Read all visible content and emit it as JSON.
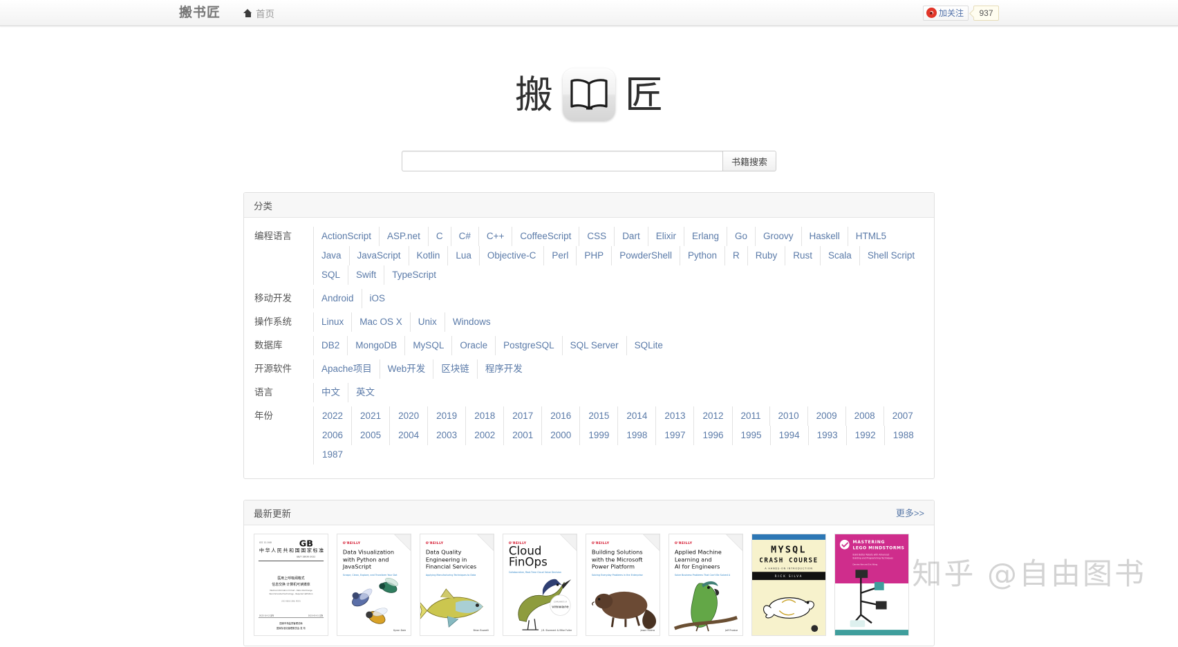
{
  "navbar": {
    "brand": "搬书匠",
    "home_label": "首页",
    "home_icon": "home-icon",
    "weibo_label": "加关注",
    "weibo_icon": "weibo-eye-icon",
    "follower_count": "937"
  },
  "logo": {
    "left_char": "搬",
    "right_char": "匠",
    "icon_name": "open-book-icon"
  },
  "search": {
    "value": "",
    "placeholder": "",
    "button_label": "书籍搜索"
  },
  "categories_panel": {
    "title": "分类",
    "rows": [
      {
        "label": "编程语言",
        "items": [
          "ActionScript",
          "ASP.net",
          "C",
          "C#",
          "C++",
          "CoffeeScript",
          "CSS",
          "Dart",
          "Elixir",
          "Erlang",
          "Go",
          "Groovy",
          "Haskell",
          "HTML5",
          "Java",
          "JavaScript",
          "Kotlin",
          "Lua",
          "Objective-C",
          "Perl",
          "PHP",
          "PowderShell",
          "Python",
          "R",
          "Ruby",
          "Rust",
          "Scala",
          "Shell Script",
          "SQL",
          "Swift",
          "TypeScript"
        ]
      },
      {
        "label": "移动开发",
        "items": [
          "Android",
          "iOS"
        ]
      },
      {
        "label": "操作系统",
        "items": [
          "Linux",
          "Mac OS X",
          "Unix",
          "Windows"
        ]
      },
      {
        "label": "数据库",
        "items": [
          "DB2",
          "MongoDB",
          "MySQL",
          "Oracle",
          "PostgreSQL",
          "SQL Server",
          "SQLite"
        ]
      },
      {
        "label": "开源软件",
        "items": [
          "Apache项目",
          "Web开发",
          "区块链",
          "程序开发"
        ]
      },
      {
        "label": "语言",
        "items": [
          "中文",
          "英文"
        ]
      },
      {
        "label": "年份",
        "items": [
          "2022",
          "2021",
          "2020",
          "2019",
          "2018",
          "2017",
          "2016",
          "2015",
          "2014",
          "2013",
          "2012",
          "2011",
          "2010",
          "2009",
          "2008",
          "2007",
          "2006",
          "2005",
          "2004",
          "2003",
          "2002",
          "2001",
          "2000",
          "1999",
          "1998",
          "1997",
          "1996",
          "1995",
          "1994",
          "1993",
          "1992",
          "1988",
          "1987"
        ]
      }
    ]
  },
  "latest_panel": {
    "title": "最新更新",
    "more_label": "更多>>",
    "books": [
      {
        "name": "gb-standard-chinese",
        "style": "gb",
        "publisher": "",
        "title_line1": "中华人民共和国国家标准",
        "badge": "GB",
        "subtitle": "医用上呼吸阀格式 信息交换 计算机可读媒体字体",
        "author": ""
      },
      {
        "name": "data-visualization-python-javascript",
        "style": "oreilly",
        "publisher": "O'REILLY",
        "title_line1": "Data Visualization",
        "title_line2": "with Python and",
        "title_line3": "JavaScript",
        "subtitle": "Scrape, Clean, Explore, and Transform Your Data",
        "author": "Kyran Dale",
        "animal": "bees"
      },
      {
        "name": "data-quality-engineering-financial-services",
        "style": "oreilly",
        "publisher": "O'REILLY",
        "title_line1": "Data Quality",
        "title_line2": "Engineering in",
        "title_line3": "Financial Services",
        "subtitle": "Applying Manufacturing Techniques to Data",
        "author": "Brian Buzzelli",
        "animal": "fish"
      },
      {
        "name": "cloud-finops",
        "style": "oreilly",
        "publisher": "O'REILLY",
        "title_line1": "Cloud",
        "title_line2": "FinOps",
        "subtitle": "Collaborative, Real-Time Cloud Value Decision Making",
        "author": "J.R. Storment & Mike Fuller",
        "animal": "bird",
        "sponsor": "vmware"
      },
      {
        "name": "building-solutions-microsoft-power-platform",
        "style": "oreilly",
        "publisher": "O'REILLY",
        "title_line1": "Building Solutions",
        "title_line2": "with the Microsoft",
        "title_line3": "Power Platform",
        "subtitle": "Solving Everyday Problems in the Enterprise",
        "author": "Jason Rivera",
        "animal": "beaver"
      },
      {
        "name": "applied-machine-learning-ai-for-engineers",
        "style": "oreilly",
        "publisher": "O'REILLY",
        "title_line1": "Applied Machine",
        "title_line2": "Learning and",
        "title_line3": "AI for Engineers",
        "subtitle": "Solve Business Problems That Can't Be Solved Algorithmically",
        "author": "Jeff Prosise",
        "animal": "parrot"
      },
      {
        "name": "mysql-crash-course",
        "style": "nostarch",
        "title_line1": "MYSQL",
        "title_line2": "CRASH COURSE",
        "subtitle": "A HANDS-ON INTRODUCTION",
        "author": "RICK SILVA"
      },
      {
        "name": "mastering-lego-mindstorms",
        "style": "nostarch-pink",
        "title_line1": "MASTERING",
        "title_line2": "LEGO MINDSTORMS",
        "subtitle": "Build Better Robots with Advanced Building and Programming Techniques",
        "author": "Damien Kee"
      }
    ]
  },
  "watermark": {
    "text": "知乎 @自由图书"
  }
}
